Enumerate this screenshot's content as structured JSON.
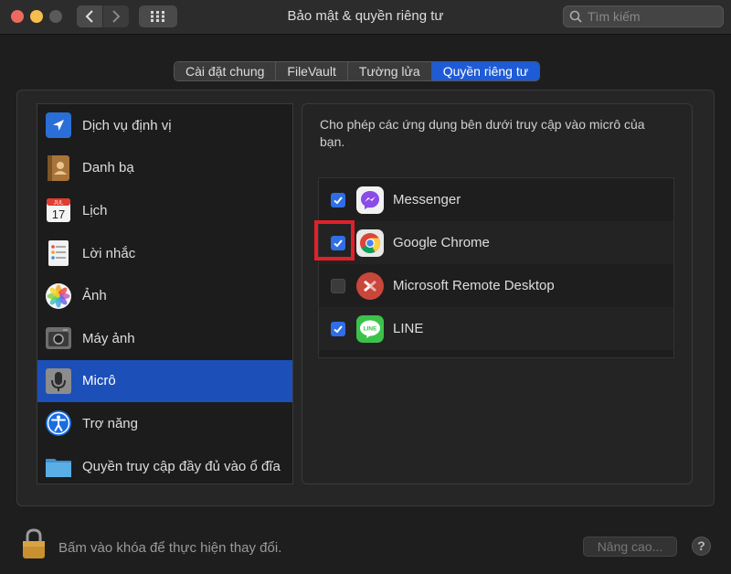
{
  "window": {
    "title": "Bảo mật & quyền riêng tư",
    "search_placeholder": "Tìm kiếm"
  },
  "tabs": [
    {
      "label": "Cài đặt chung",
      "active": false
    },
    {
      "label": "FileVault",
      "active": false
    },
    {
      "label": "Tường lửa",
      "active": false
    },
    {
      "label": "Quyền riêng tư",
      "active": true
    }
  ],
  "sidebar": {
    "items": [
      {
        "label": "Dịch vụ định vị",
        "icon": "location-arrow-icon"
      },
      {
        "label": "Danh bạ",
        "icon": "contacts-book-icon"
      },
      {
        "label": "Lịch",
        "icon": "calendar-icon",
        "icon_text": [
          "JUL",
          "17"
        ]
      },
      {
        "label": "Lời nhắc",
        "icon": "reminders-icon"
      },
      {
        "label": "Ảnh",
        "icon": "photos-icon"
      },
      {
        "label": "Máy ảnh",
        "icon": "camera-icon"
      },
      {
        "label": "Micrô",
        "icon": "microphone-icon",
        "selected": true
      },
      {
        "label": "Trợ năng",
        "icon": "accessibility-icon"
      },
      {
        "label": "Quyền truy cập đầy đủ vào ổ đĩa",
        "icon": "folder-icon"
      }
    ]
  },
  "main": {
    "description": "Cho phép các ứng dụng bên dưới truy cập vào micrô của bạn.",
    "apps": [
      {
        "name": "Messenger",
        "checked": true,
        "icon": "messenger-icon"
      },
      {
        "name": "Google Chrome",
        "checked": true,
        "icon": "chrome-icon",
        "highlighted": true
      },
      {
        "name": "Microsoft Remote Desktop",
        "checked": false,
        "icon": "remote-desktop-icon"
      },
      {
        "name": "LINE",
        "checked": true,
        "icon": "line-icon"
      }
    ]
  },
  "footer": {
    "lock_text": "Bấm vào khóa để thực hiện thay đổi.",
    "advanced_label": "Nâng cao...",
    "help_label": "?"
  },
  "colors": {
    "accent": "#1e5bd6",
    "selected_row": "#1c4fb8",
    "highlight_box": "#e2202a"
  }
}
